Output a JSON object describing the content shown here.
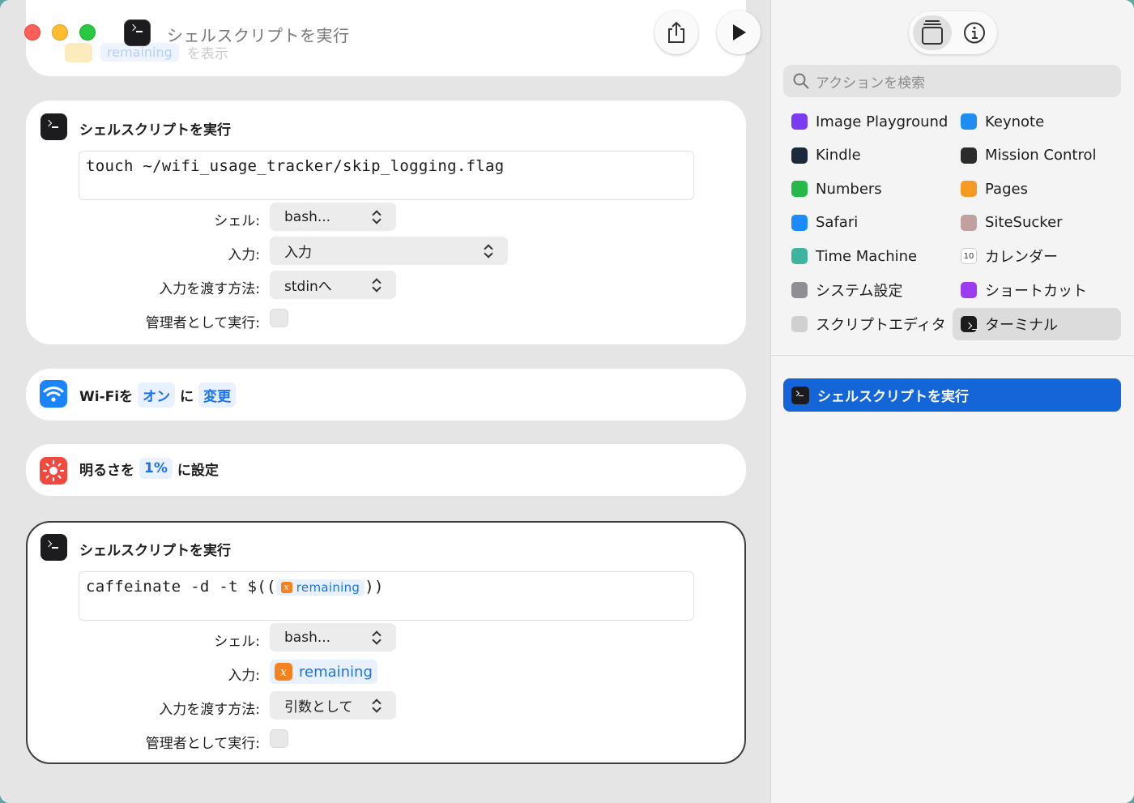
{
  "window": {
    "title": "シェルスクリプトを実行"
  },
  "faded_prev": {
    "chip": "remaining",
    "suffix": "を表示"
  },
  "shell1": {
    "title": "シェルスクリプトを実行",
    "script": "touch ~/wifi_usage_tracker/skip_logging.flag",
    "shell_label": "シェル:",
    "shell_value": "bash...",
    "input_label": "入力:",
    "input_value": "入力",
    "pass_label": "入力を渡す方法:",
    "pass_value": "stdinへ",
    "admin_label": "管理者として実行:"
  },
  "wifi": {
    "prefix": "Wi-Fiを",
    "state": "オン",
    "mid": "に",
    "action": "変更"
  },
  "brightness": {
    "prefix": "明るさを",
    "value": "1%",
    "suffix": "に設定"
  },
  "shell2": {
    "title": "シェルスクリプトを実行",
    "script_prefix": "caffeinate -d -t $((",
    "script_var": "remaining",
    "script_suffix": "))",
    "shell_label": "シェル:",
    "shell_value": "bash...",
    "input_label": "入力:",
    "input_var": "remaining",
    "pass_label": "入力を渡す方法:",
    "pass_value": "引数として",
    "admin_label": "管理者として実行:"
  },
  "sidebar": {
    "search_placeholder": "アクションを検索",
    "apps": [
      {
        "label": "Image Playground",
        "icon": "image-playground-icon",
        "color": "#7a3cf0"
      },
      {
        "label": "Keynote",
        "icon": "keynote-icon",
        "color": "#1f8cf0"
      },
      {
        "label": "Kindle",
        "icon": "kindle-icon",
        "color": "#1b2a3a"
      },
      {
        "label": "Mission Control",
        "icon": "mission-control-icon",
        "color": "#2b2b2b"
      },
      {
        "label": "Numbers",
        "icon": "numbers-icon",
        "color": "#27b84a"
      },
      {
        "label": "Pages",
        "icon": "pages-icon",
        "color": "#f59a23"
      },
      {
        "label": "Safari",
        "icon": "safari-icon",
        "color": "#1a8cff"
      },
      {
        "label": "SiteSucker",
        "icon": "sitesucker-icon",
        "color": "#c0a0a0"
      },
      {
        "label": "Time Machine",
        "icon": "time-machine-icon",
        "color": "#3fb3a0"
      },
      {
        "label": "カレンダー",
        "icon": "calendar-icon",
        "color": "#ffffff"
      },
      {
        "label": "システム設定",
        "icon": "system-settings-icon",
        "color": "#8e8e93"
      },
      {
        "label": "ショートカット",
        "icon": "shortcuts-icon",
        "color": "#9b3cf0"
      },
      {
        "label": "スクリプトエディタ",
        "icon": "script-editor-icon",
        "color": "#d0d0d0"
      },
      {
        "label": "ターミナル",
        "icon": "terminal-icon",
        "color": "#1c1c1e"
      }
    ],
    "calendar_day": "10",
    "selected_app": "ターミナル",
    "result_label": "シェルスクリプトを実行"
  }
}
